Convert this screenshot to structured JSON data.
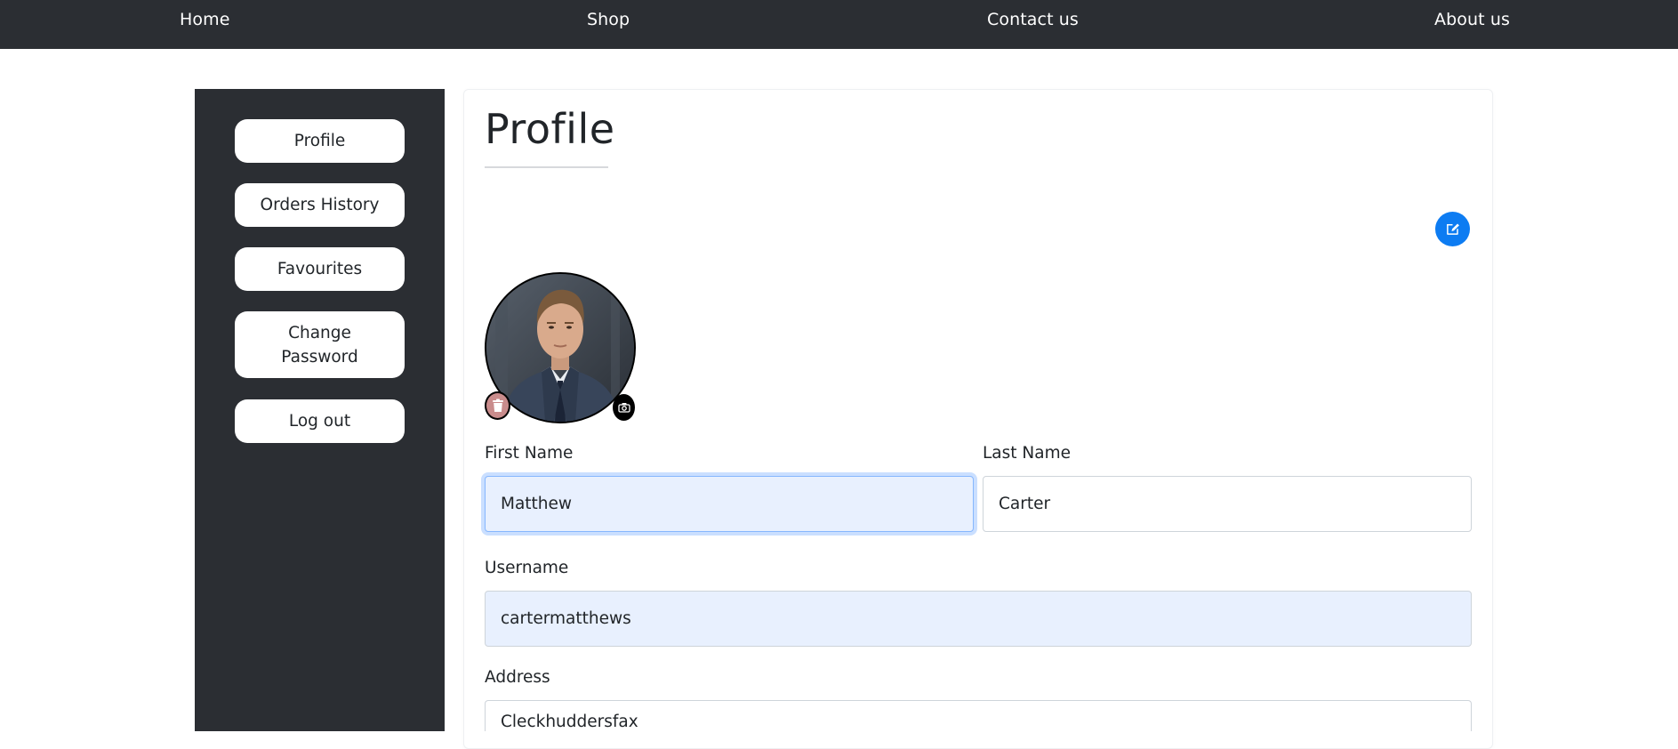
{
  "nav": {
    "items": [
      {
        "label": "Home"
      },
      {
        "label": "Shop"
      },
      {
        "label": "Contact us"
      },
      {
        "label": "About us"
      }
    ]
  },
  "sidebar": {
    "items": [
      {
        "label": "Profile"
      },
      {
        "label": "Orders History"
      },
      {
        "label": "Favourites"
      },
      {
        "label": "Change Password"
      },
      {
        "label": "Log out"
      }
    ]
  },
  "profile": {
    "title": "Profile",
    "fields": {
      "first_name": {
        "label": "First Name",
        "value": "Matthew"
      },
      "last_name": {
        "label": "Last Name",
        "value": "Carter"
      },
      "username": {
        "label": "Username",
        "value": "cartermatthews"
      },
      "address": {
        "label": "Address",
        "value": "Cleckhuddersfax"
      }
    }
  },
  "icons": {
    "edit": "edit-icon",
    "delete_photo": "trash-icon",
    "change_photo": "camera-icon"
  },
  "colors": {
    "nav_bg": "#2b2e33",
    "accent": "#0d7cf2",
    "autofill_bg": "#e8f0fe",
    "delete_bg": "#c98c8c"
  }
}
